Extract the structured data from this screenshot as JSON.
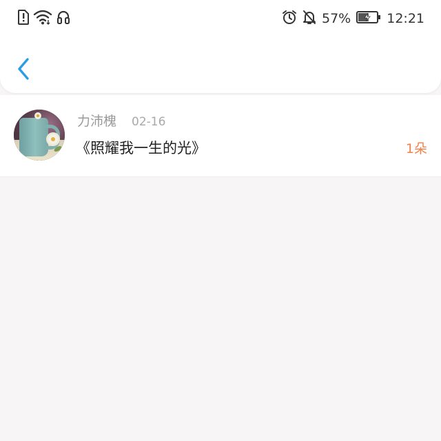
{
  "status_bar": {
    "battery_percent_text": "57%",
    "time": "12:21",
    "battery_level": 0.57,
    "icons_left": [
      "sim-alert-icon",
      "wifi-icon",
      "headset-icon"
    ],
    "icons_right": [
      "alarm-icon",
      "mute-bell-icon",
      "battery-charging-icon"
    ]
  },
  "nav": {
    "back_icon": "chevron-left-icon",
    "accent_color": "#2a9de6"
  },
  "records": [
    {
      "name": "力沛槐",
      "date": "02-16",
      "title": "《照耀我一生的光》",
      "count": "1朵",
      "count_color": "#f0814a"
    }
  ]
}
